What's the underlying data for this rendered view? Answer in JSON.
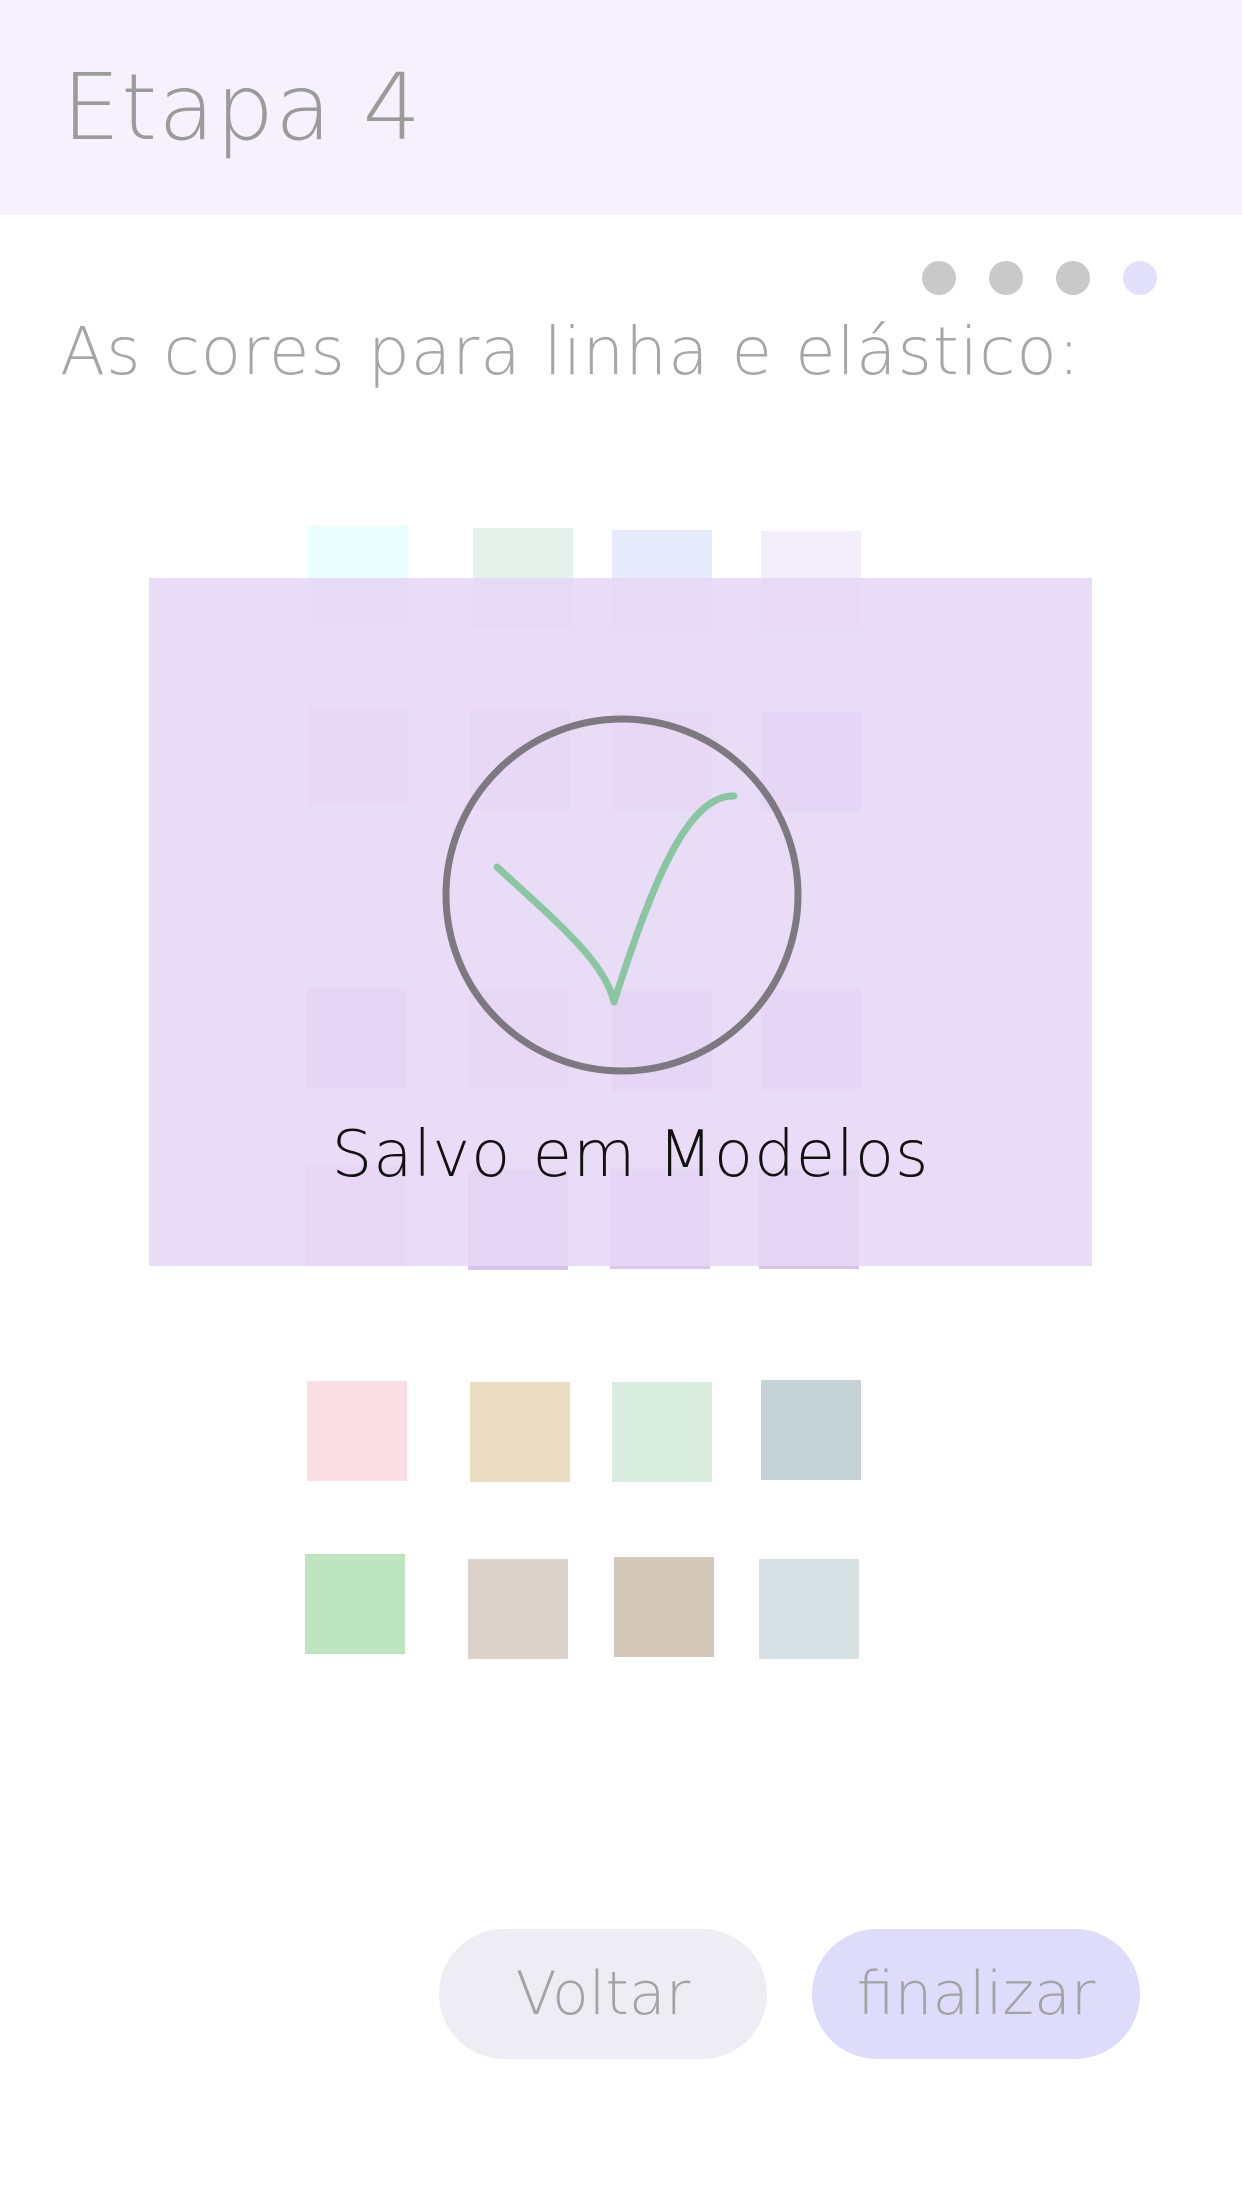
{
  "header": {
    "title": "Etapa 4"
  },
  "progress": {
    "total_steps": 4,
    "current_step": 4,
    "inactive_color": "#c9c9c9",
    "active_color": "#e2e0fb"
  },
  "question": "As cores para linha e elástico:",
  "swatches": [
    {
      "id": "swatch-1",
      "color": "#eafffd"
    },
    {
      "id": "swatch-2",
      "color": "#e5f2ec"
    },
    {
      "id": "swatch-3",
      "color": "#e6eafd"
    },
    {
      "id": "swatch-4",
      "color": "#f4eefc"
    },
    {
      "id": "swatch-5",
      "color": "#eedcf2"
    },
    {
      "id": "swatch-6",
      "color": "#eadcf4"
    },
    {
      "id": "swatch-7",
      "color": "#ebe1f6"
    },
    {
      "id": "swatch-8",
      "color": "#ddcaea"
    },
    {
      "id": "swatch-9",
      "color": "#d8cdf4"
    },
    {
      "id": "swatch-10",
      "color": "#e9d8f2"
    },
    {
      "id": "swatch-11",
      "color": "#dac8ea"
    },
    {
      "id": "swatch-12",
      "color": "#dbcdee"
    },
    {
      "id": "swatch-13",
      "color": "#ecd0e6"
    },
    {
      "id": "swatch-14",
      "color": "#d7c4ee"
    },
    {
      "id": "swatch-15",
      "color": "#dcccec"
    },
    {
      "id": "swatch-16",
      "color": "#d6c3ea"
    },
    {
      "id": "swatch-17",
      "color": "#fbdde4"
    },
    {
      "id": "swatch-18",
      "color": "#ebdcc4"
    },
    {
      "id": "swatch-19",
      "color": "#daede1"
    },
    {
      "id": "swatch-20",
      "color": "#c5d3d4"
    },
    {
      "id": "swatch-21",
      "color": "#bde5bf"
    },
    {
      "id": "swatch-22",
      "color": "#dcd1cb"
    },
    {
      "id": "swatch-23",
      "color": "#d3c8b9"
    },
    {
      "id": "swatch-24",
      "color": "#d7e0e2"
    }
  ],
  "confirmation": {
    "message": "Salvo em Modelos",
    "circle_color": "#7c7a80",
    "check_color": "#8bc6a3"
  },
  "buttons": {
    "back": "Voltar",
    "finish": "finalizar"
  }
}
